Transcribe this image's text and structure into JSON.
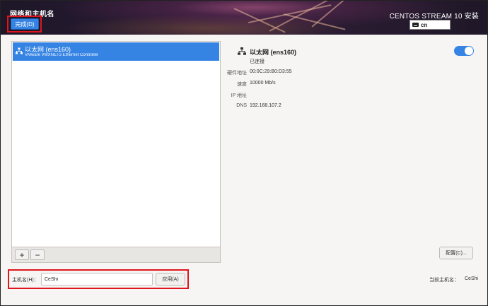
{
  "header": {
    "page_title": "网络和主机名",
    "done_label": "完成(D)",
    "install_title": "CENTOS STREAM 10 安装",
    "keyboard_layout": "cn"
  },
  "device_list": {
    "items": [
      {
        "name": "以太网 (ens160)",
        "description": "VMware VMXNET3 Ethernet Controller",
        "selected": true
      }
    ],
    "add_label": "+",
    "remove_label": "−"
  },
  "detail": {
    "name": "以太网 (ens160)",
    "status": "已连接",
    "enabled": true,
    "properties": [
      {
        "label": "硬件地址",
        "value": "00:0C:29:B0:D3:55"
      },
      {
        "label": "速度",
        "value": "10000 Mb/s"
      },
      {
        "label": "IP 地址",
        "value": ""
      },
      {
        "label": "DNS",
        "value": "192.168.107.2"
      }
    ],
    "config_label": "配置(C)..."
  },
  "hostname": {
    "label": "主机名(H)：",
    "value": "CeShi",
    "apply_label": "应用(A)",
    "current_label": "当前主机名：",
    "current_value": "CeShi"
  },
  "colors": {
    "accent": "#3584e4",
    "highlight": "#e0151d"
  },
  "icons": {
    "network": "network-wired-icon",
    "keyboard": "keyboard-icon"
  }
}
